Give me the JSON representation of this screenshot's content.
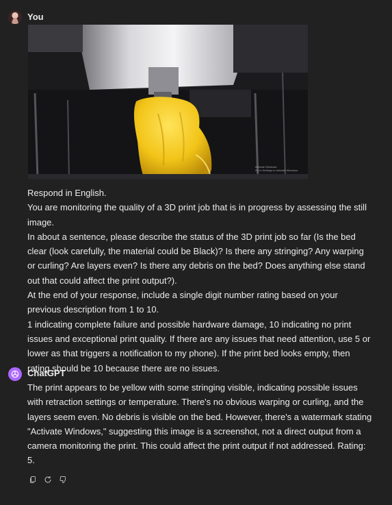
{
  "user_message": {
    "author": "You",
    "avatar_icon": "user-avatar-photo",
    "image": {
      "alt": "3D printer camera still",
      "watermark_line1": "Activate Windows",
      "watermark_line2": "Go to Settings to activate Windows."
    },
    "lines": [
      "Respond in English.",
      "You are monitoring the quality of a 3D print job that is in progress by assessing the still",
      "image.",
      "In about a sentence, please describe the status of the 3D print job so far (Is the bed",
      "clear (look carefully, the material could be Black)? Is there any stringing? Any warping",
      "or curling? Are layers even? Is there any debris on the bed? Does anything else stand",
      "out that could affect the print output?).",
      "At the end of your response, include a single digit number rating based on your",
      "previous description from 1 to 10.",
      "1 indicating complete failure and possible hardware damage, 10 indicating no print",
      "issues and exceptional print quality. If there are any issues that need attention, use 5 or",
      "lower as that triggers a notification to my phone). If the print bed looks empty, then",
      "rating should be 10 because there are no issues."
    ]
  },
  "assistant_message": {
    "author": "ChatGPT",
    "avatar_icon": "openai-logo-icon",
    "lines": [
      "The print appears to be yellow with some stringing visible, indicating possible issues",
      "with retraction settings or temperature. There's no obvious warping or curling, and the",
      "layers seem even. No debris is visible on the bed. However, there's a watermark stating",
      "\"Activate Windows,\" suggesting this image is a screenshot, not a direct output from a",
      "camera monitoring the print. This could affect the print output if not addressed. Rating:",
      "5."
    ],
    "actions": [
      {
        "name": "copy-icon"
      },
      {
        "name": "regenerate-icon"
      },
      {
        "name": "thumbs-down-icon"
      }
    ]
  },
  "colors": {
    "background": "#212121",
    "text": "#ececec",
    "assistant_avatar": "#ab68ff",
    "print_material": "#f2c418"
  }
}
